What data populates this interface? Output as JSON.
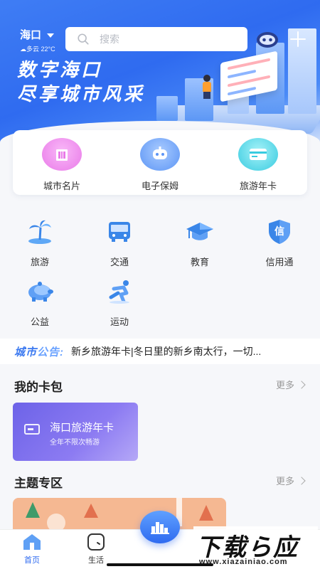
{
  "header": {
    "city": "海口",
    "weather": "☁多云 22°C",
    "search_placeholder": "搜索",
    "slogan_line1": "数字海口",
    "slogan_line2": "尽享城市风采"
  },
  "featured": [
    {
      "label": "城市名片",
      "icon": "building-icon",
      "color": "#f5a0f5"
    },
    {
      "label": "电子保姆",
      "icon": "robot-icon",
      "color": "#7db1ff"
    },
    {
      "label": "旅游年卡",
      "icon": "card-icon",
      "color": "#6fe2f0"
    }
  ],
  "services": [
    {
      "label": "旅游",
      "icon": "palm-tree-icon"
    },
    {
      "label": "交通",
      "icon": "bus-icon"
    },
    {
      "label": "教育",
      "icon": "graduation-cap-icon"
    },
    {
      "label": "信用通",
      "icon": "credit-shield-icon",
      "glyph": "信"
    },
    {
      "label": "公益",
      "icon": "piggy-bank-icon"
    },
    {
      "label": "运动",
      "icon": "runner-icon"
    }
  ],
  "notice": {
    "tag_a": "城市",
    "tag_b": "公告:",
    "text": "新乡旅游年卡|冬日里的新乡南太行，一切..."
  },
  "wallet": {
    "title": "我的卡包",
    "more": "更多",
    "card_title": "海口旅游年卡",
    "card_subtitle": "全年不限次畅游"
  },
  "topics": {
    "title": "主题专区",
    "more": "更多"
  },
  "tabs": [
    {
      "label": "首页",
      "icon": "home-icon",
      "active": true
    },
    {
      "label": "生活",
      "icon": "life-icon",
      "active": false
    }
  ],
  "watermark": {
    "main": "下载ら应用",
    "url": "www.xiazainiao.com"
  },
  "colors": {
    "primary": "#2f6bf0",
    "accent_purple": "#6d63e8"
  }
}
